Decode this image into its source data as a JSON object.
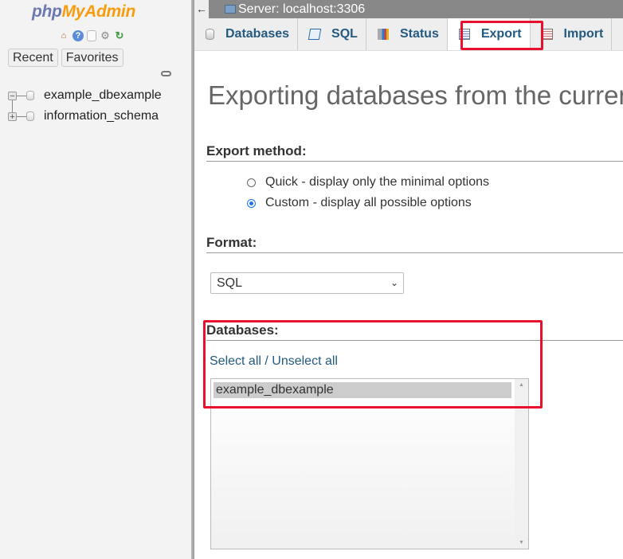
{
  "sidebar": {
    "logo_php": "php",
    "logo_myadmin": "MyAdmin",
    "icons": [
      "home-icon",
      "help-icon",
      "docs-icon",
      "settings-gear-icon",
      "reload-icon"
    ],
    "recent_label": "Recent",
    "favorites_label": "Favorites",
    "tree": [
      {
        "label": "example_dbexample",
        "expander": "−"
      },
      {
        "label": "information_schema",
        "expander": "+"
      }
    ]
  },
  "topbar": {
    "back": "←",
    "server": "Server: localhost:3306"
  },
  "tabs": [
    {
      "label": "Databases",
      "icon": "database-icon"
    },
    {
      "label": "SQL",
      "icon": "sql-icon"
    },
    {
      "label": "Status",
      "icon": "status-chart-icon"
    },
    {
      "label": "Export",
      "icon": "export-icon",
      "active": true
    },
    {
      "label": "Import",
      "icon": "import-icon"
    }
  ],
  "main": {
    "title": "Exporting databases from the current server",
    "export_method_heading": "Export method:",
    "export_methods": [
      {
        "label": "Quick - display only the minimal options",
        "checked": false
      },
      {
        "label": "Custom - display all possible options",
        "checked": true
      }
    ],
    "format_heading": "Format:",
    "format_value": "SQL",
    "databases_heading": "Databases:",
    "select_all": "Select all",
    "separator": " / ",
    "unselect_all": "Unselect all",
    "databases": [
      "example_dbexample"
    ]
  },
  "annotations": {
    "highlight_color": "#e8112d"
  }
}
